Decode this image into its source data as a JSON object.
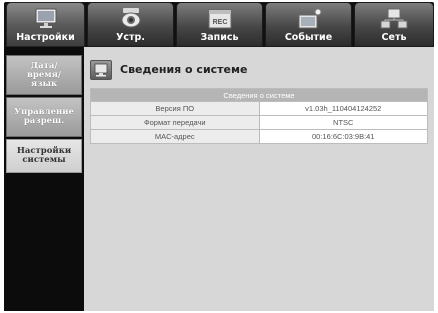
{
  "tabs": [
    {
      "label": "Настройки",
      "icon": "monitor-settings-icon"
    },
    {
      "label": "Устр.",
      "icon": "camera-icon"
    },
    {
      "label": "Запись",
      "icon": "rec-icon"
    },
    {
      "label": "Событие",
      "icon": "event-icon"
    },
    {
      "label": "Сеть",
      "icon": "network-icon"
    }
  ],
  "sidebar": {
    "items": [
      {
        "label": "Дата/\nвремя/\nязык"
      },
      {
        "label": "Управление\nразреш."
      },
      {
        "label": "Настройки\nсистемы"
      }
    ],
    "active_index": 2
  },
  "page": {
    "title": "Сведения о системе",
    "icon": "system-info-icon"
  },
  "info_table": {
    "header": "Сведения о системе",
    "rows": [
      {
        "label": "Версия ПО",
        "value": "v1.03h_110404124252"
      },
      {
        "label": "Формат передачи",
        "value": "NTSC"
      },
      {
        "label": "MAC-адрес",
        "value": "00:16:6C:03:9B:41"
      }
    ]
  },
  "colors": {
    "content_bg": "#d7d7d7",
    "frame_bg": "#111111",
    "table_header_bg": "#b5b5b5"
  }
}
